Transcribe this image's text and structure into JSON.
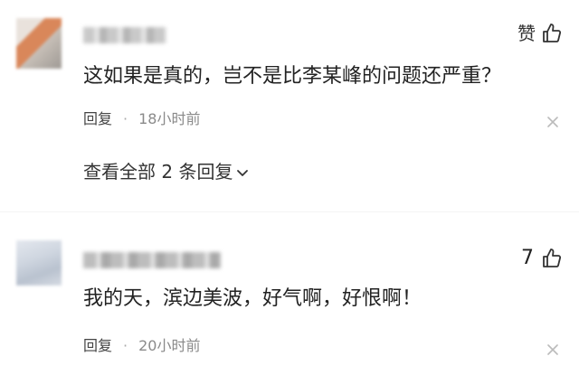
{
  "comments": [
    {
      "like_label": "赞",
      "like_count": "",
      "text": "这如果是真的，岂不是比李某峰的问题还严重？",
      "reply_label": "回复",
      "separator": "·",
      "time": "18小时前",
      "thumb_icon": "thumbs-up-icon",
      "more_icon": "close-x-icon"
    },
    {
      "like_label": "",
      "like_count": "7",
      "text": "我的天，滨边美波，好气啊，好恨啊！",
      "reply_label": "回复",
      "separator": "·",
      "time": "20小时前",
      "thumb_icon": "thumbs-up-icon",
      "more_icon": "close-x-icon"
    }
  ],
  "view_replies": {
    "label": "查看全部 2 条回复",
    "icon": "chevron-down-icon"
  },
  "colors": {
    "text_primary": "#222222",
    "text_meta": "#8a8a8a",
    "background": "#ffffff"
  }
}
